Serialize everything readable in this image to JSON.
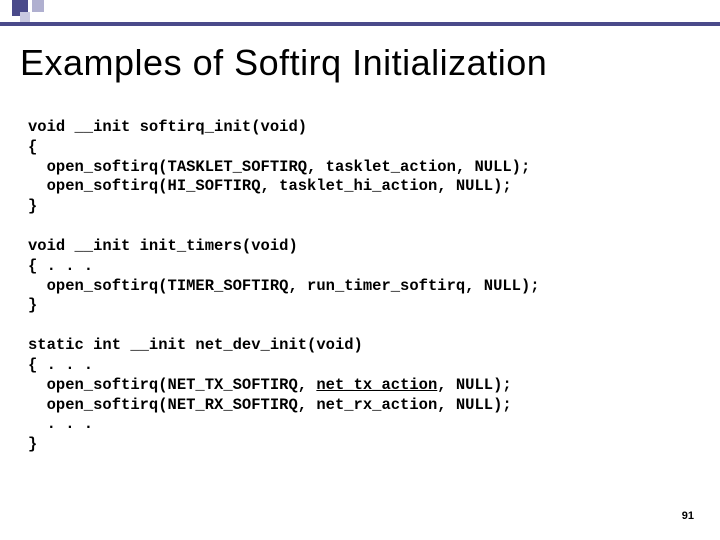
{
  "title": "Examples of Softirq Initialization",
  "code": {
    "b1l1": "void __init softirq_init(void)",
    "b1l2": "{",
    "b1l3": "  open_softirq(TASKLET_SOFTIRQ, tasklet_action, NULL);",
    "b1l4": "  open_softirq(HI_SOFTIRQ, tasklet_hi_action, NULL);",
    "b1l5": "}",
    "b2l1": "void __init init_timers(void)",
    "b2l2": "{ . . .",
    "b2l3": "  open_softirq(TIMER_SOFTIRQ, run_timer_softirq, NULL);",
    "b2l4": "}",
    "b3l1": "static int __init net_dev_init(void)",
    "b3l2": "{ . . .",
    "b3l3a": "  open_softirq(NET_TX_SOFTIRQ, ",
    "b3l3u": "net_tx_action",
    "b3l3b": ", NULL);",
    "b3l4": "  open_softirq(NET_RX_SOFTIRQ, net_rx_action, NULL);",
    "b3l5": "  . . .",
    "b3l6": "}"
  },
  "page_number": "91"
}
